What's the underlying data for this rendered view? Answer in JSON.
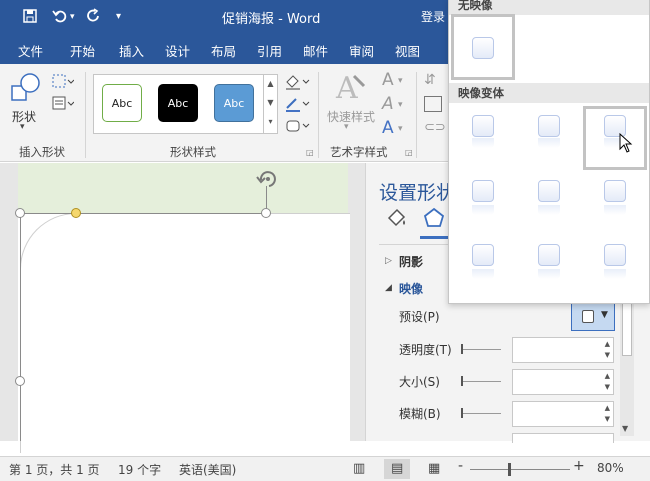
{
  "titlebar": {
    "title": "促销海报 - Word",
    "login": "登录",
    "qat": {
      "save_icon": "save-icon",
      "undo_icon": "undo-icon",
      "redo_icon": "redo-icon",
      "customize_icon": "customize-qat-icon"
    }
  },
  "tabs": [
    "文件",
    "开始",
    "插入",
    "设计",
    "布局",
    "引用",
    "邮件",
    "审阅",
    "视图"
  ],
  "ribbon": {
    "insert_shape": {
      "label": "插入形状",
      "shape_button": "形状"
    },
    "shape_styles": {
      "label": "形状样式",
      "styles": [
        "Abc",
        "Abc",
        "Abc"
      ]
    },
    "wordart": {
      "label": "艺术字样式",
      "quick_styles": "快速样式",
      "letters": [
        "A",
        "A",
        "A"
      ]
    }
  },
  "pane": {
    "title": "设置形状",
    "sections": {
      "shadow": "阴影",
      "reflection": "映像"
    },
    "fields": {
      "preset": "预设(P)",
      "transparency": "透明度(T)",
      "size": "大小(S)",
      "blur": "模糊(B)"
    }
  },
  "gallery": {
    "no_reflection_header": "无映像",
    "variants_header": "映像变体"
  },
  "status": {
    "page": "第 1 页，共 1 页",
    "words": "19 个字",
    "language": "英语(美国)",
    "zoom": "80%",
    "zoom_minus": "-",
    "zoom_plus": "+"
  },
  "colors": {
    "accent": "#2b579a",
    "style_green": "#70ad47",
    "style_black": "#000000",
    "style_blue": "#5b9bd5"
  }
}
